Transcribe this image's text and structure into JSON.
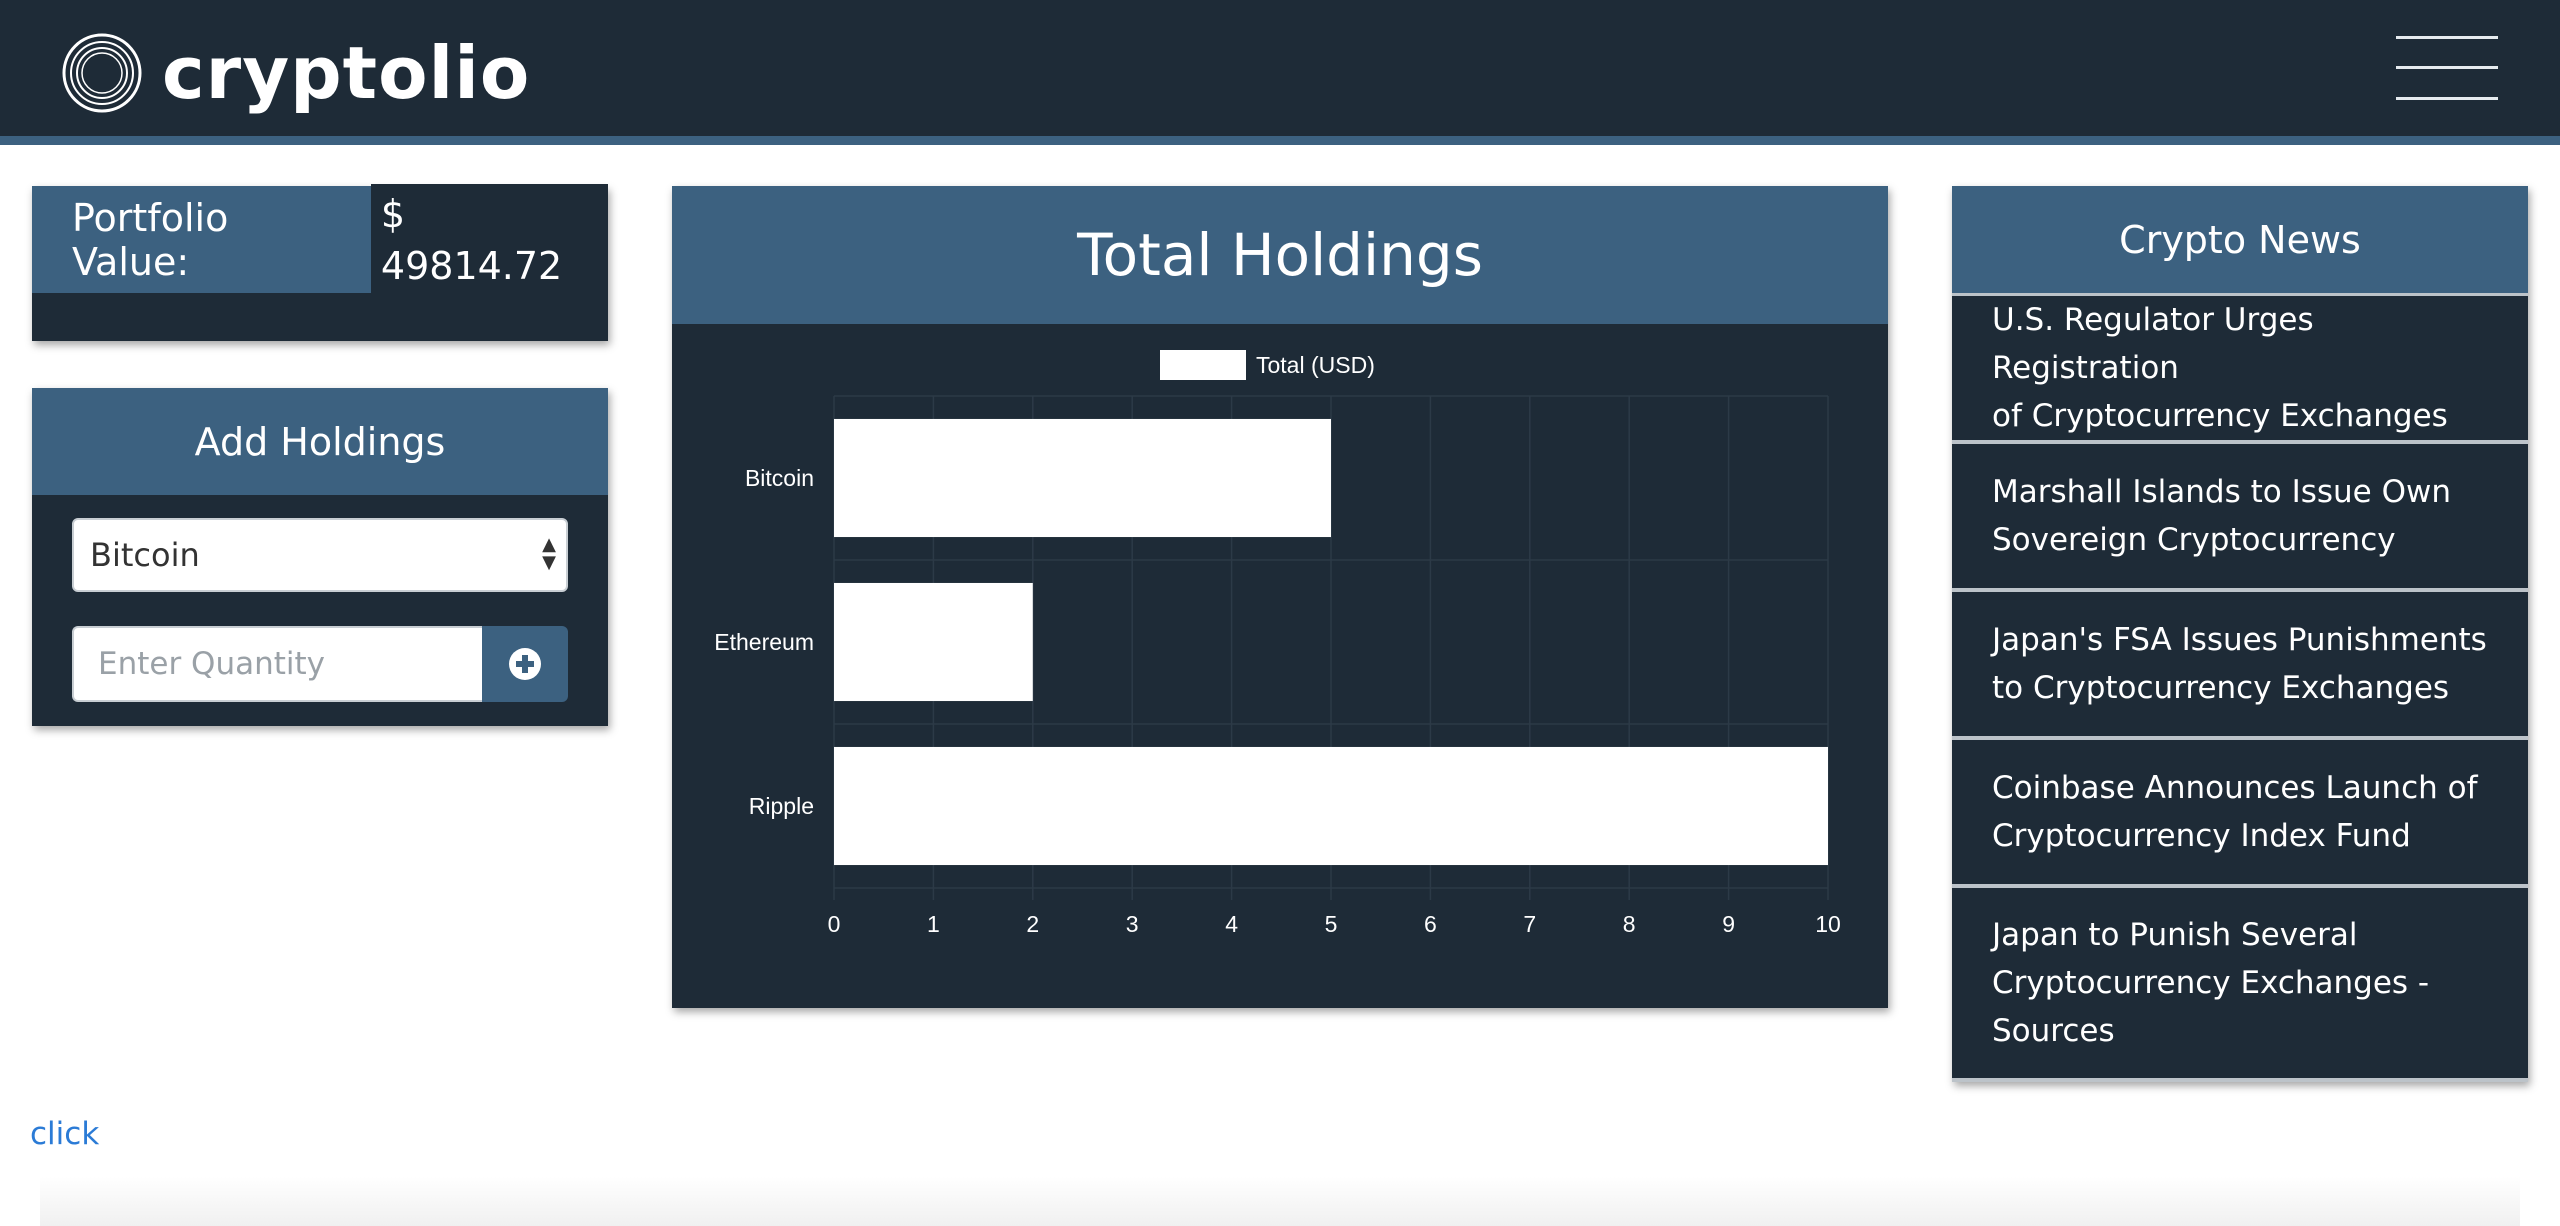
{
  "header": {
    "logo_text": "cryptolio",
    "menu_icon": "hamburger-menu-icon"
  },
  "portfolio": {
    "label": "Portfolio Value:",
    "value": "$ 49814.72"
  },
  "add_holdings": {
    "title": "Add Holdings",
    "selected_coin": "Bitcoin",
    "quantity_placeholder": "Enter Quantity",
    "add_icon": "plus-circle-icon"
  },
  "holdings": {
    "title": "Total Holdings"
  },
  "chart_data": {
    "type": "bar",
    "orientation": "horizontal",
    "categories": [
      "Bitcoin",
      "Ethereum",
      "Ripple"
    ],
    "series": [
      {
        "name": "Total (USD)",
        "values": [
          5,
          2,
          10
        ]
      }
    ],
    "xlim": [
      0,
      10
    ],
    "x_ticks": [
      "0",
      "1",
      "2",
      "3",
      "4",
      "5",
      "6",
      "7",
      "8",
      "9",
      "10"
    ],
    "grid": true,
    "legend_position": "top"
  },
  "news": {
    "title": "Crypto News",
    "items": [
      {
        "lines": [
          "U.S. Regulator Urges Registration",
          "of Cryptocurrency Exchanges"
        ]
      },
      {
        "lines": [
          "Marshall Islands to Issue Own",
          "Sovereign Cryptocurrency"
        ]
      },
      {
        "lines": [
          "Japan's FSA Issues Punishments",
          "to Cryptocurrency Exchanges"
        ]
      },
      {
        "lines": [
          "Coinbase Announces Launch of",
          "Cryptocurrency Index Fund"
        ]
      },
      {
        "lines": [
          "Japan to Punish Several",
          "Cryptocurrency Exchanges -",
          "Sources"
        ]
      }
    ]
  },
  "footer": {
    "link_text": "click"
  },
  "colors": {
    "header_bg": "#1e2b37",
    "accent": "#3c6180",
    "panel_bg": "#1e2b37",
    "bar_fill": "#ffffff",
    "link": "#2b7bd6"
  }
}
